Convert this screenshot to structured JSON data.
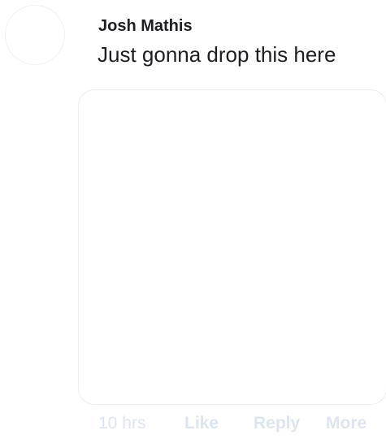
{
  "comment": {
    "author": "Josh Mathis",
    "text": "Just gonna drop this here",
    "timestamp": "10 hrs",
    "actions": {
      "like": "Like",
      "reply": "Reply",
      "more": "More"
    }
  }
}
